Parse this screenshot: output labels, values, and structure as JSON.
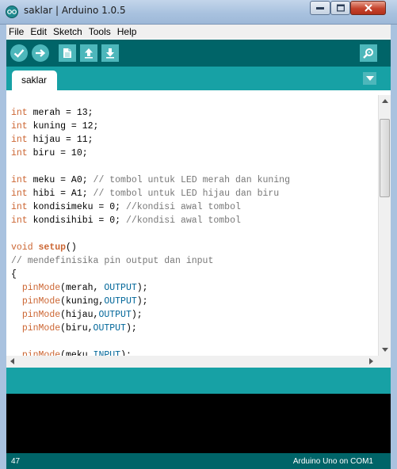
{
  "window": {
    "title": "saklar | Arduino 1.0.5"
  },
  "menu": {
    "items": [
      "File",
      "Edit",
      "Sketch",
      "Tools",
      "Help"
    ]
  },
  "toolbar": {
    "buttons": [
      "verify",
      "upload",
      "new",
      "open",
      "save",
      "serial-monitor"
    ]
  },
  "tabs": {
    "active": "saklar"
  },
  "editor": {
    "lines": [
      [
        {
          "t": "int",
          "c": "kw"
        },
        {
          "t": " merah = 13;"
        }
      ],
      [
        {
          "t": "int",
          "c": "kw"
        },
        {
          "t": " kuning = 12;"
        }
      ],
      [
        {
          "t": "int",
          "c": "kw"
        },
        {
          "t": " hijau = 11;"
        }
      ],
      [
        {
          "t": "int",
          "c": "kw"
        },
        {
          "t": " biru = 10;"
        }
      ],
      [],
      [
        {
          "t": "int",
          "c": "kw"
        },
        {
          "t": " meku = A0; "
        },
        {
          "t": "// tombol untuk LED merah dan kuning",
          "c": "cmt"
        }
      ],
      [
        {
          "t": "int",
          "c": "kw"
        },
        {
          "t": " hibi = A1; "
        },
        {
          "t": "// tombol untuk LED hijau dan biru",
          "c": "cmt"
        }
      ],
      [
        {
          "t": "int",
          "c": "kw"
        },
        {
          "t": " kondisimeku = 0; "
        },
        {
          "t": "//kondisi awal tombol",
          "c": "cmt"
        }
      ],
      [
        {
          "t": "int",
          "c": "kw"
        },
        {
          "t": " kondisihibi = 0; "
        },
        {
          "t": "//kondisi awal tombol",
          "c": "cmt"
        }
      ],
      [],
      [
        {
          "t": "void",
          "c": "kw"
        },
        {
          "t": " "
        },
        {
          "t": "setup",
          "c": "kw-func"
        },
        {
          "t": "()"
        }
      ],
      [
        {
          "t": "// mendefinisika pin output dan input",
          "c": "cmt"
        }
      ],
      [
        {
          "t": "{"
        }
      ],
      [
        {
          "t": "  "
        },
        {
          "t": "pinMode",
          "c": "kw"
        },
        {
          "t": "(merah, "
        },
        {
          "t": "OUTPUT",
          "c": "const"
        },
        {
          "t": ");"
        }
      ],
      [
        {
          "t": "  "
        },
        {
          "t": "pinMode",
          "c": "kw"
        },
        {
          "t": "(kuning,"
        },
        {
          "t": "OUTPUT",
          "c": "const"
        },
        {
          "t": ");"
        }
      ],
      [
        {
          "t": "  "
        },
        {
          "t": "pinMode",
          "c": "kw"
        },
        {
          "t": "(hijau,"
        },
        {
          "t": "OUTPUT",
          "c": "const"
        },
        {
          "t": ");"
        }
      ],
      [
        {
          "t": "  "
        },
        {
          "t": "pinMode",
          "c": "kw"
        },
        {
          "t": "(biru,"
        },
        {
          "t": "OUTPUT",
          "c": "const"
        },
        {
          "t": ");"
        }
      ],
      [],
      [
        {
          "t": "  "
        },
        {
          "t": "pinMode",
          "c": "kw"
        },
        {
          "t": "(meku,"
        },
        {
          "t": "INPUT",
          "c": "const"
        },
        {
          "t": ");"
        }
      ]
    ]
  },
  "status": {
    "line_number": "47",
    "board": "Arduino Uno on COM1"
  },
  "colors": {
    "toolbar": "#006468",
    "tabstrip": "#17a1a5",
    "button": "#4db7bb",
    "keyword": "#cc6633",
    "constant": "#006699",
    "comment": "#777777"
  }
}
